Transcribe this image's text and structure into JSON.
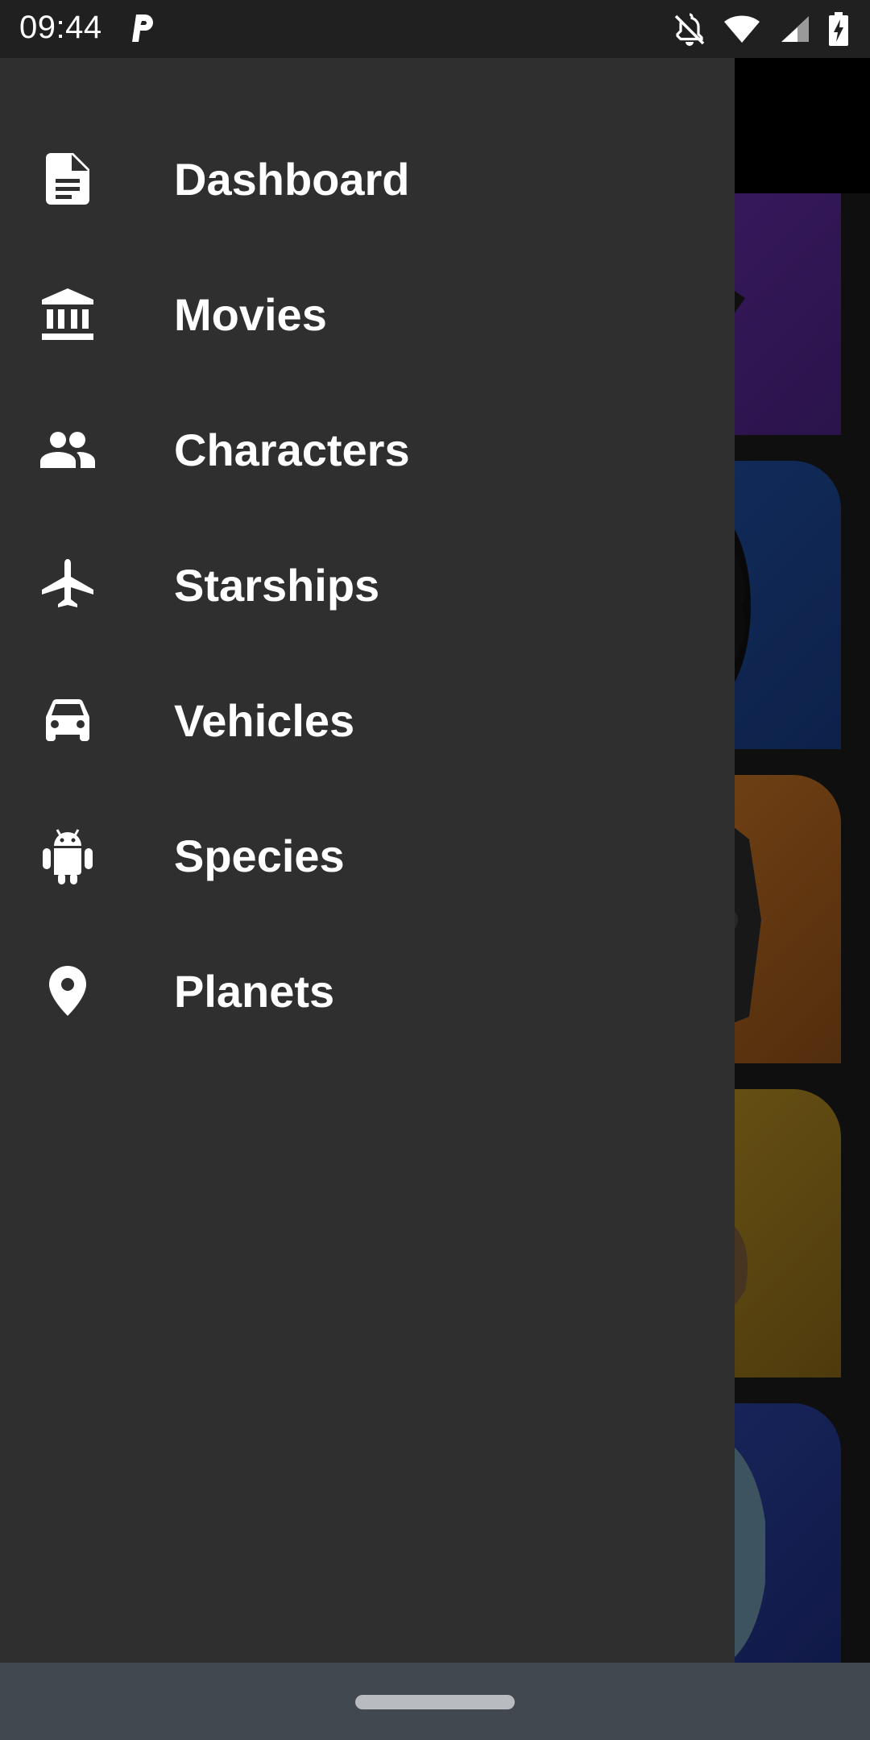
{
  "status_bar": {
    "time": "09:44",
    "icons": [
      "parking-icon",
      "notifications-off-icon",
      "wifi-icon",
      "signal-icon",
      "battery-charging-icon"
    ]
  },
  "drawer": {
    "items": [
      {
        "label": "Dashboard",
        "icon": "document-icon"
      },
      {
        "label": "Movies",
        "icon": "bank-icon"
      },
      {
        "label": "Characters",
        "icon": "people-icon"
      },
      {
        "label": "Starships",
        "icon": "airplane-icon"
      },
      {
        "label": "Vehicles",
        "icon": "car-icon"
      },
      {
        "label": "Species",
        "icon": "android-icon"
      },
      {
        "label": "Planets",
        "icon": "location-pin-icon"
      }
    ]
  },
  "colors": {
    "drawer_bg": "#2f2f2f",
    "status_bar_bg": "#202020",
    "nav_bar_bg": "#414850",
    "card_colors": [
      "#5e2b9e",
      "#1f4a9a",
      "#c06f23",
      "#b08a22",
      "#2a3f9c"
    ]
  }
}
